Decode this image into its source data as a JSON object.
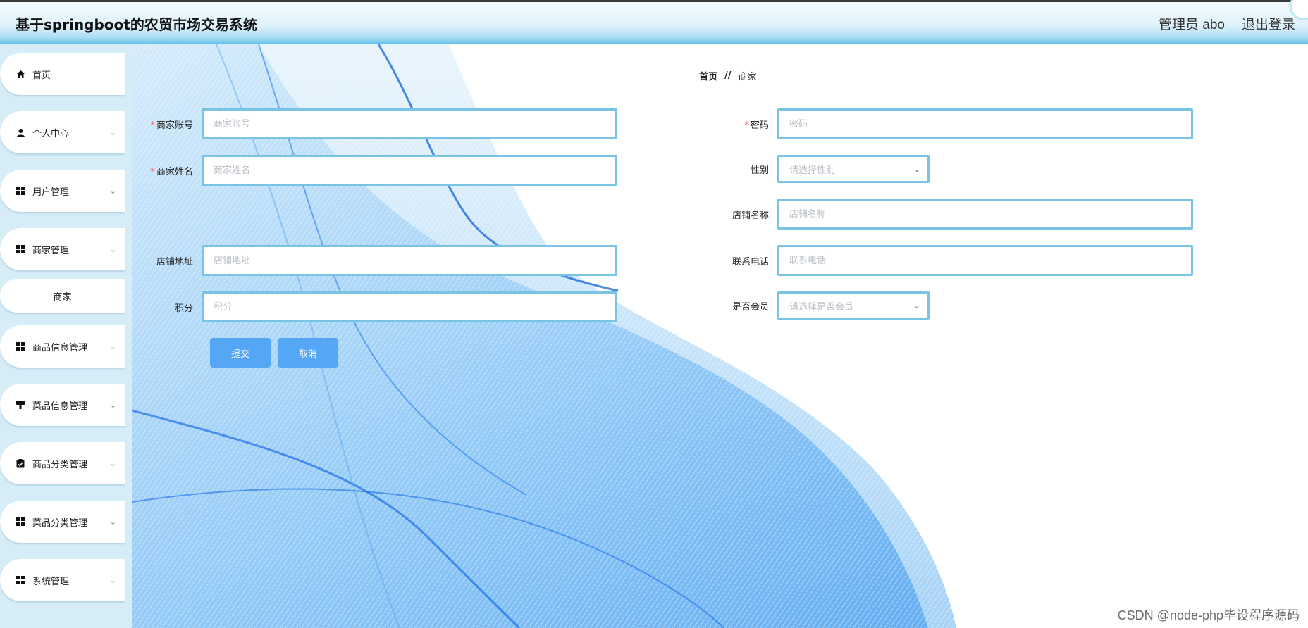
{
  "header": {
    "title": "基于springboot的农贸市场交易系统",
    "user": "管理员 abo",
    "logout": "退出登录"
  },
  "sidebar": {
    "items": [
      {
        "label": "首页",
        "icon": "home-icon",
        "has_chevron": false
      },
      {
        "label": "个人中心",
        "icon": "user-icon",
        "has_chevron": true
      },
      {
        "label": "用户管理",
        "icon": "grid-icon",
        "has_chevron": true
      },
      {
        "label": "商家管理",
        "icon": "grid-icon",
        "has_chevron": true
      },
      {
        "label": "商家",
        "icon": "",
        "has_chevron": false,
        "submenu": true
      },
      {
        "label": "商品信息管理",
        "icon": "grid-icon",
        "has_chevron": true
      },
      {
        "label": "菜品信息管理",
        "icon": "stamp-icon",
        "has_chevron": true
      },
      {
        "label": "商品分类管理",
        "icon": "clipboard-icon",
        "has_chevron": true
      },
      {
        "label": "菜品分类管理",
        "icon": "grid-icon",
        "has_chevron": true
      },
      {
        "label": "系统管理",
        "icon": "grid-icon",
        "has_chevron": true
      }
    ]
  },
  "breadcrumb": {
    "home": "首页",
    "separator": "//",
    "current": "商家"
  },
  "form": {
    "account": {
      "label": "商家账号",
      "placeholder": "商家账号",
      "required": true
    },
    "password": {
      "label": "密码",
      "placeholder": "密码",
      "required": true
    },
    "name": {
      "label": "商家姓名",
      "placeholder": "商家姓名",
      "required": true
    },
    "gender": {
      "label": "性别",
      "placeholder": "请选择性别"
    },
    "shop_name": {
      "label": "店铺名称",
      "placeholder": "店铺名称"
    },
    "shop_address": {
      "label": "店铺地址",
      "placeholder": "店铺地址"
    },
    "phone": {
      "label": "联系电话",
      "placeholder": "联系电话"
    },
    "points": {
      "label": "积分",
      "placeholder": "积分"
    },
    "member": {
      "label": "是否会员",
      "placeholder": "请选择是否会员"
    },
    "submit": "提交",
    "cancel": "取消"
  },
  "watermark": "CSDN @node-php毕设程序源码",
  "colors": {
    "accent": "#56a6f6",
    "input_border": "#79c4e4",
    "sidebar_bg": "#d6ecf6",
    "required": "#f56c6c"
  }
}
